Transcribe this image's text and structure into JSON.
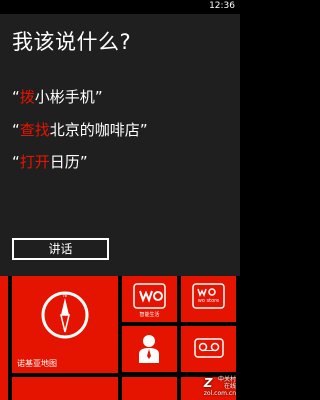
{
  "status_bar": {
    "time": "12:36"
  },
  "speech_panel": {
    "title": "我该说什么?",
    "examples": [
      {
        "open": "“",
        "keyword": "拨",
        "rest": "小彬手机",
        "close": "”"
      },
      {
        "open": "“",
        "keyword": "查找",
        "rest": "北京的咖啡店",
        "close": "”"
      },
      {
        "open": "“",
        "keyword": "打开",
        "rest": "日历",
        "close": "”"
      }
    ],
    "speak_button": "讲话",
    "keyword_color": "#e51400"
  },
  "start_tiles": {
    "accent_color": "#e51400",
    "maps_tile": {
      "label": "诺基亚地图",
      "icon": "compass-icon"
    },
    "small_tiles": [
      {
        "icon": "wo-icon",
        "caption": "智能生活"
      },
      {
        "icon": "wo-store-icon",
        "caption": "wo store"
      },
      {
        "icon": "person-icon",
        "caption": ""
      },
      {
        "icon": "tape-icon",
        "caption": ""
      }
    ]
  },
  "watermark": {
    "logo": "Z",
    "line1": "中关村在线",
    "line2": "zol.com.cn"
  }
}
